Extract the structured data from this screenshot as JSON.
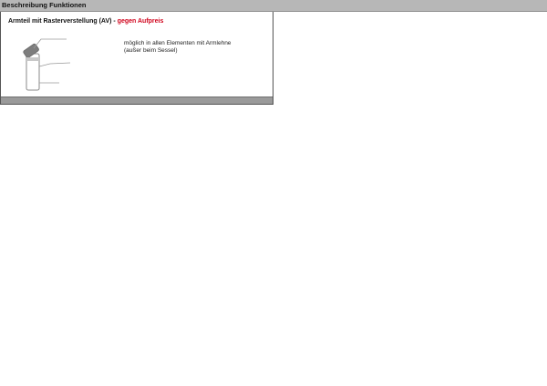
{
  "header": {
    "title": "Beschreibung Funktionen"
  },
  "section": {
    "heading_main": "Armteil mit Rasterverstellung (AV) - ",
    "heading_price": "gegen Aufpreis",
    "price_color": "#d0021b",
    "diagram_icon": "armrest-adjustment-icon",
    "description_lines": [
      "möglich in allen Elementen mit Armlehne",
      "(außer beim Sessel)"
    ]
  }
}
